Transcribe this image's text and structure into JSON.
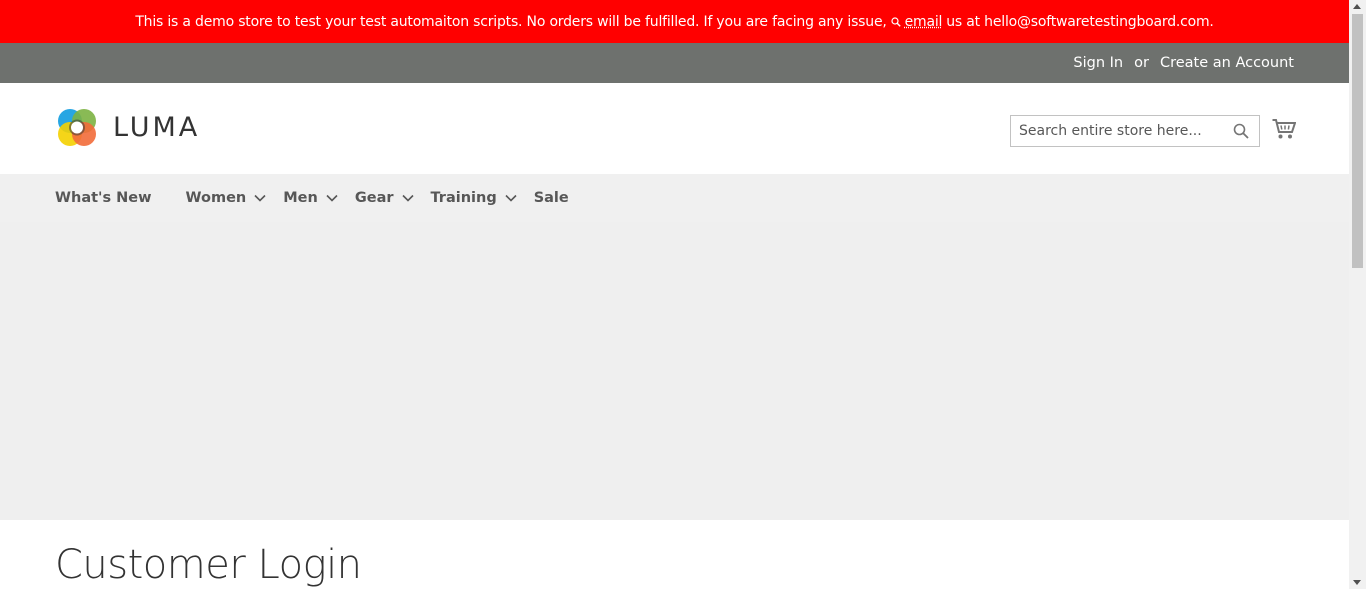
{
  "notice": {
    "text_before": "This is a demo store to test your test automaiton scripts. No orders will be fulfilled. If you are facing any issue,",
    "email_link": "email",
    "text_after": "us at hello@softwaretestingboard.com."
  },
  "top_links": {
    "sign_in": "Sign In",
    "separator": "or",
    "create_account": "Create an Account"
  },
  "header": {
    "logo_text": "LUMA",
    "search_placeholder": "Search entire store here..."
  },
  "nav": {
    "items": [
      {
        "label": "What's New",
        "has_dropdown": false
      },
      {
        "label": "Women",
        "has_dropdown": true
      },
      {
        "label": "Men",
        "has_dropdown": true
      },
      {
        "label": "Gear",
        "has_dropdown": true
      },
      {
        "label": "Training",
        "has_dropdown": true
      },
      {
        "label": "Sale",
        "has_dropdown": false
      }
    ]
  },
  "main": {
    "page_title": "Customer Login"
  },
  "colors": {
    "notice_bg": "#ff0000",
    "top_bar_bg": "#6e716e",
    "nav_bg": "#f0f0f0",
    "text": "#333333"
  },
  "icons": [
    "search-icon",
    "cart-icon",
    "chevron-down-icon",
    "luma-logo"
  ]
}
